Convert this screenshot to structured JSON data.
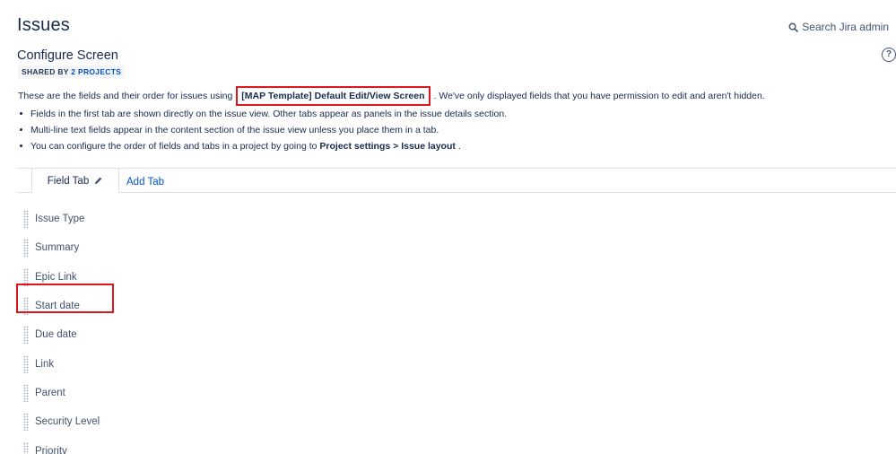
{
  "header": {
    "title": "Issues",
    "search_label": "Search Jira admin"
  },
  "section": {
    "title": "Configure Screen",
    "shared_prefix": "SHARED BY",
    "shared_link": "2 PROJECTS"
  },
  "description": {
    "before": "These are the fields and their order for issues using",
    "screen_name": "[MAP Template] Default Edit/View Screen",
    "after": ". We've only displayed fields that you have permission to edit and aren't hidden."
  },
  "bullets": [
    {
      "text": "Fields in the first tab are shown directly on the issue view. Other tabs appear as panels in the issue details section."
    },
    {
      "text": "Multi-line text fields appear in the content section of the issue view unless you place them in a tab."
    },
    {
      "text_before": "You can configure the order of fields and tabs in a project by going to",
      "bold1": "Project settings",
      "sep": ">",
      "bold2": "Issue layout",
      "text_after": "."
    }
  ],
  "tabs": {
    "field_tab_label": "Field Tab",
    "add_tab_label": "Add Tab"
  },
  "fields": [
    "Issue Type",
    "Summary",
    "Epic Link",
    "Start date",
    "Due date",
    "Link",
    "Parent",
    "Security Level",
    "Priority"
  ],
  "colors": {
    "highlight": "#e0161f",
    "link": "#0052cc"
  },
  "icons": {
    "search": "search-icon",
    "help": "help-icon",
    "edit": "pencil-icon",
    "drag": "drag-handle-icon"
  }
}
